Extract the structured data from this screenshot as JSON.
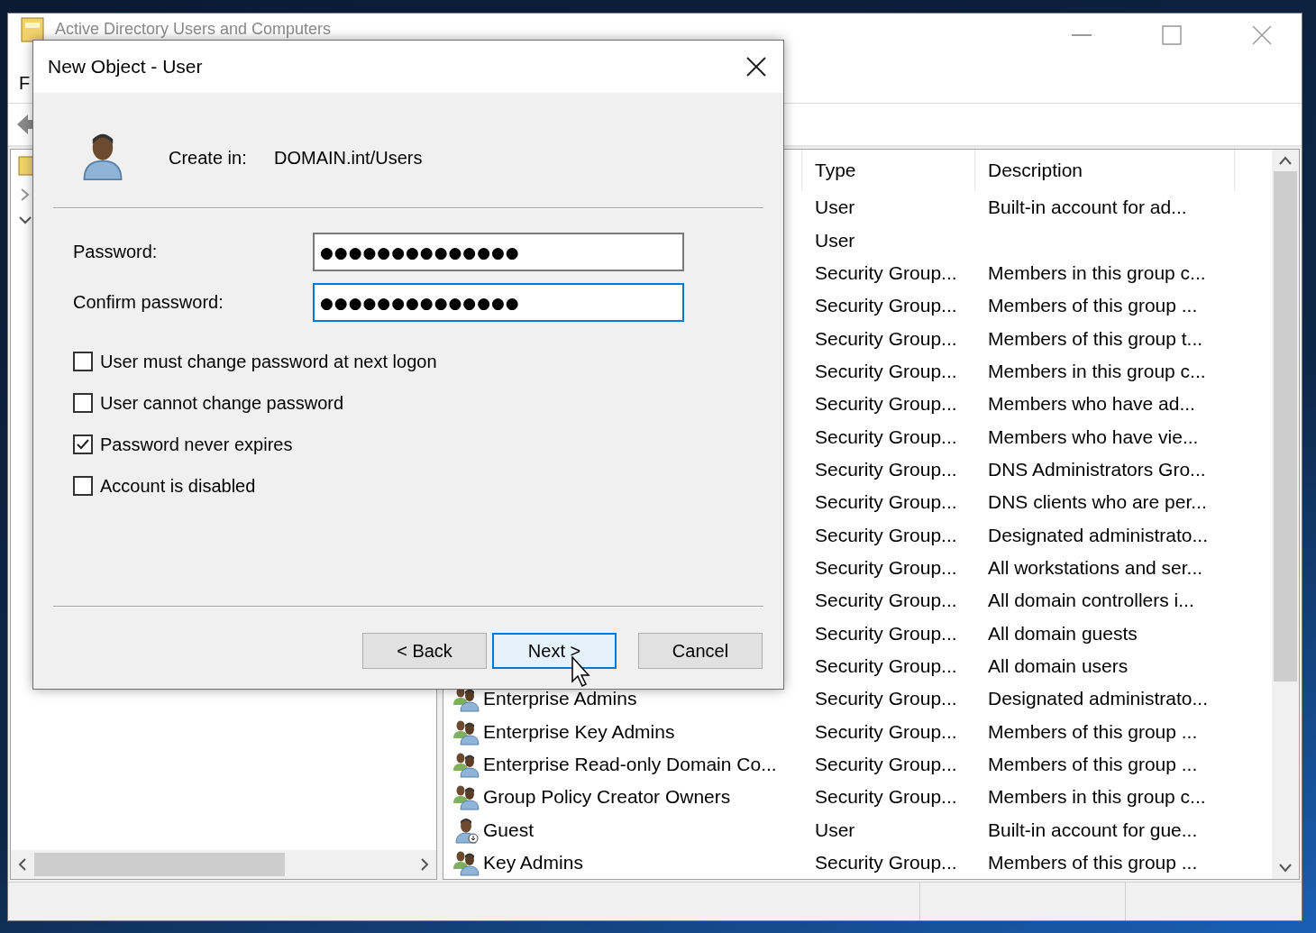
{
  "main_window": {
    "title": "Active Directory Users and Computers",
    "menu": [
      "F"
    ]
  },
  "list": {
    "columns": [
      "Type",
      "Description"
    ],
    "rows": [
      {
        "type": "User",
        "description": "Built-in account for ad..."
      },
      {
        "type": "User"
      },
      {
        "type": "Security Group...",
        "description": "Members in this group c..."
      },
      {
        "type": "Security Group...",
        "description": "Members of this group ..."
      },
      {
        "type": "Security Group...",
        "description": "Members of this group t..."
      },
      {
        "type": "Security Group...",
        "description": "Members in this group c..."
      },
      {
        "type": "Security Group...",
        "description": "Members who have ad..."
      },
      {
        "type": "Security Group...",
        "description": "Members who have vie..."
      },
      {
        "type": "Security Group...",
        "description": "DNS Administrators Gro..."
      },
      {
        "type": "Security Group...",
        "description": "DNS clients who are per..."
      },
      {
        "type": "Security Group...",
        "description": "Designated administrato..."
      },
      {
        "type": "Security Group...",
        "description": "All workstations and ser..."
      },
      {
        "type": "Security Group...",
        "description": "All domain controllers i..."
      },
      {
        "type": "Security Group...",
        "description": "All domain guests"
      },
      {
        "type": "Security Group...",
        "description": "All domain users"
      },
      {
        "name": "Enterprise Admins",
        "kind": "group",
        "type": "Security Group...",
        "description": "Designated administrato..."
      },
      {
        "name": "Enterprise Key Admins",
        "kind": "group",
        "type": "Security Group...",
        "description": "Members of this group ..."
      },
      {
        "name": "Enterprise Read-only Domain Co...",
        "kind": "group",
        "type": "Security Group...",
        "description": "Members of this group ..."
      },
      {
        "name": "Group Policy Creator Owners",
        "kind": "group",
        "type": "Security Group...",
        "description": "Members in this group c..."
      },
      {
        "name": "Guest",
        "kind": "user",
        "type": "User",
        "description": "Built-in account for gue..."
      },
      {
        "name": "Key Admins",
        "kind": "group",
        "type": "Security Group...",
        "description": "Members of this group ..."
      }
    ]
  },
  "dialog": {
    "title": "New Object - User",
    "create_in_label": "Create in:",
    "create_in_value": "DOMAIN.int/Users",
    "fields": [
      {
        "label": "Password:",
        "value": "●●●●●●●●●●●●●●",
        "focused": false
      },
      {
        "label": "Confirm password:",
        "value": "●●●●●●●●●●●●●●",
        "focused": true
      }
    ],
    "options": [
      {
        "label": "User must change password at next logon",
        "checked": false
      },
      {
        "label": "User cannot change password",
        "checked": false
      },
      {
        "label": "Password never expires",
        "checked": true
      },
      {
        "label": "Account is disabled",
        "checked": false
      }
    ],
    "buttons": [
      {
        "label": "< Back",
        "default": false
      },
      {
        "label": "Next >",
        "default": true
      },
      {
        "label": "Cancel",
        "default": false
      }
    ]
  }
}
